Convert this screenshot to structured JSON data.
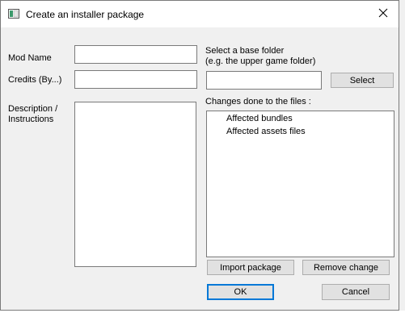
{
  "window": {
    "title": "Create an installer package",
    "app_icon": "window-app-icon",
    "close_icon": "close-icon"
  },
  "form": {
    "mod_name_label": "Mod Name",
    "mod_name_value": "",
    "credits_label": "Credits (By...)",
    "credits_value": "",
    "description_label_line1": "Description /",
    "description_label_line2": "Instructions",
    "description_value": "",
    "base_folder_label_line1": "Select a base folder",
    "base_folder_label_line2": "(e.g. the upper game folder)",
    "base_folder_value": "",
    "select_button": "Select",
    "changes_label": "Changes done to the files :",
    "changes_items": [
      "Affected bundles",
      "Affected assets files"
    ],
    "import_button": "Import package",
    "remove_button": "Remove change",
    "ok_button": "OK",
    "cancel_button": "Cancel"
  }
}
